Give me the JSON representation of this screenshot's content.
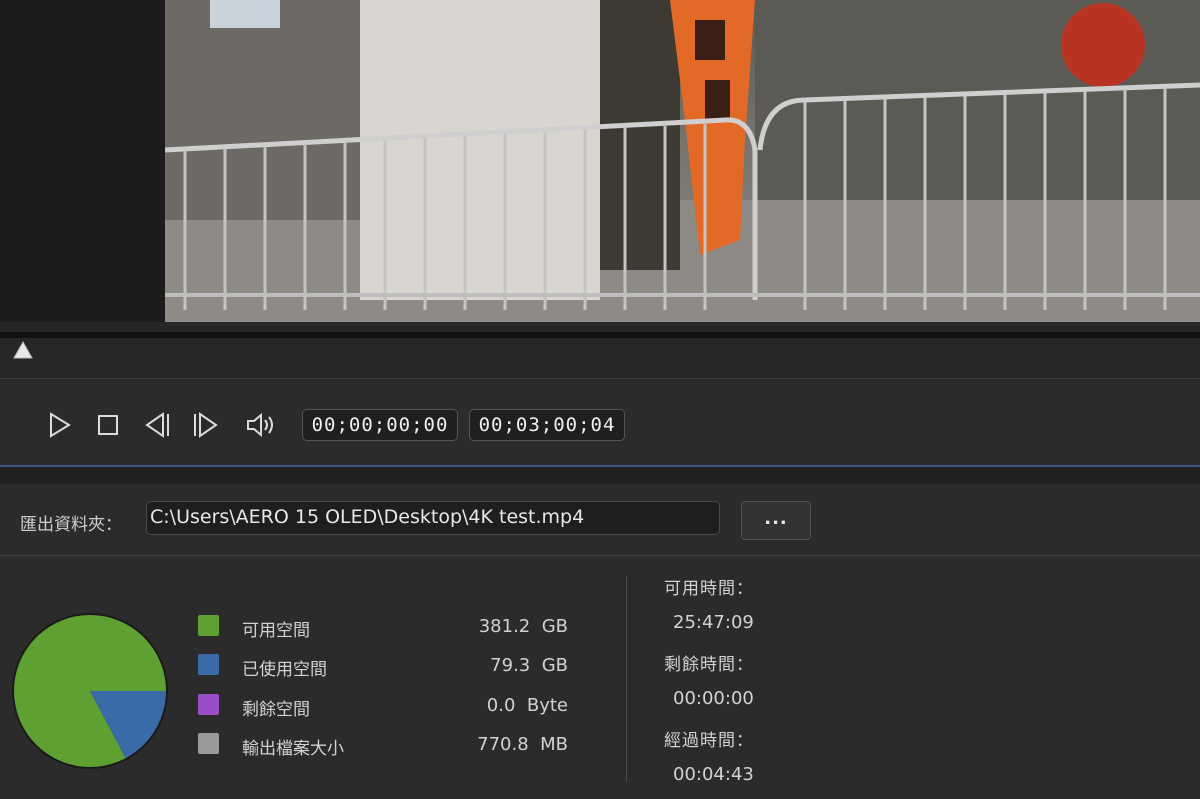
{
  "player": {
    "timecode_current": "00;00;00;00",
    "timecode_duration": "00;03;00;04",
    "progress": 0
  },
  "export": {
    "label": "匯出資料夾：",
    "path": "C:\\Users\\AERO 15 OLED\\Desktop\\4K test.mp4",
    "browse_label": "..."
  },
  "storage": {
    "chart_data": {
      "type": "pie",
      "slices": [
        {
          "label": "可用空間",
          "value": 381.2,
          "unit": "GB",
          "color": "#5fa033"
        },
        {
          "label": "已使用空間",
          "value": 79.3,
          "unit": "GB",
          "color": "#3a6aa8"
        },
        {
          "label": "剩餘空間",
          "value": 0.0,
          "unit": "Byte",
          "color": "#9b4fc6"
        },
        {
          "label": "輸出檔案大小",
          "value": 770.8,
          "unit": "MB",
          "color": "#9a9a9a"
        }
      ]
    },
    "legend": [
      {
        "label": "可用空間",
        "value": "381.2  GB",
        "color": "#5fa033"
      },
      {
        "label": "已使用空間",
        "value": "79.3  GB",
        "color": "#3a6aa8"
      },
      {
        "label": "剩餘空間",
        "value": "0.0  Byte",
        "color": "#9b4fc6"
      },
      {
        "label": "輸出檔案大小",
        "value": "770.8  MB",
        "color": "#9a9a9a"
      }
    ]
  },
  "times": {
    "available_label": "可用時間：",
    "available_value": "25:47:09",
    "remaining_label": "剩餘時間：",
    "remaining_value": "00:00:00",
    "elapsed_label": "經過時間：",
    "elapsed_value": "00:04:43"
  }
}
